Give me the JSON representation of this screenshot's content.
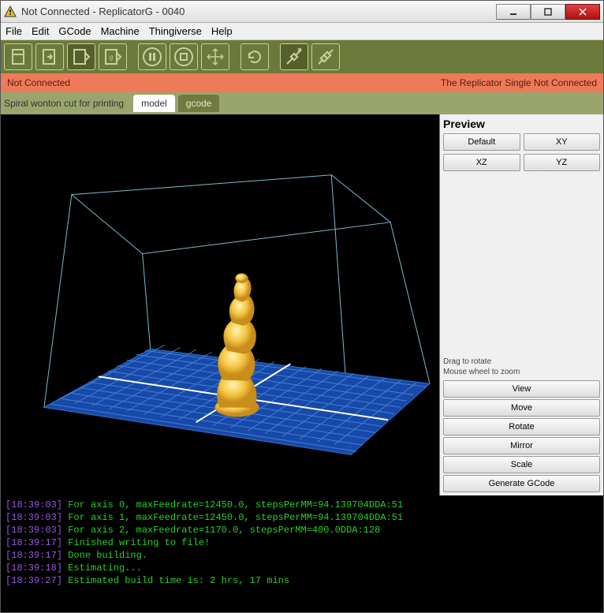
{
  "window": {
    "title": "Not Connected - ReplicatorG - 0040"
  },
  "menubar": [
    "File",
    "Edit",
    "GCode",
    "Machine",
    "Thingiverse",
    "Help"
  ],
  "status": {
    "left": "Not Connected",
    "right": "The Replicator Single Not Connected"
  },
  "file": {
    "name": "Spiral wonton cut for printing",
    "tabs": {
      "model": "model",
      "gcode": "gcode"
    }
  },
  "preview": {
    "title": "Preview",
    "default": "Default",
    "xy": "XY",
    "xz": "XZ",
    "yz": "YZ",
    "hint1": "Drag to rotate",
    "hint2": "Mouse wheel to zoom"
  },
  "actions": {
    "view": "View",
    "move": "Move",
    "rotate": "Rotate",
    "mirror": "Mirror",
    "scale": "Scale",
    "gengcode": "Generate GCode"
  },
  "console": [
    {
      "ts": "[18:39:03]",
      "msg": " For axis 0, maxFeedrate=12450.0, stepsPerMM=94.139704DDA:51"
    },
    {
      "ts": "[18:39:03]",
      "msg": " For axis 1, maxFeedrate=12450.0, stepsPerMM=94.139704DDA:51"
    },
    {
      "ts": "[18:39:03]",
      "msg": " For axis 2, maxFeedrate=1170.0, stepsPerMM=400.0DDA:128"
    },
    {
      "ts": "[18:39:17]",
      "msg": " Finished writing to file!"
    },
    {
      "ts": "[18:39:17]",
      "msg": " Done building."
    },
    {
      "ts": "[18:39:18]",
      "msg": " Estimating..."
    },
    {
      "ts": "[18:39:27]",
      "msg": " Estimated build time is: 2 hrs, 17 mins"
    }
  ]
}
